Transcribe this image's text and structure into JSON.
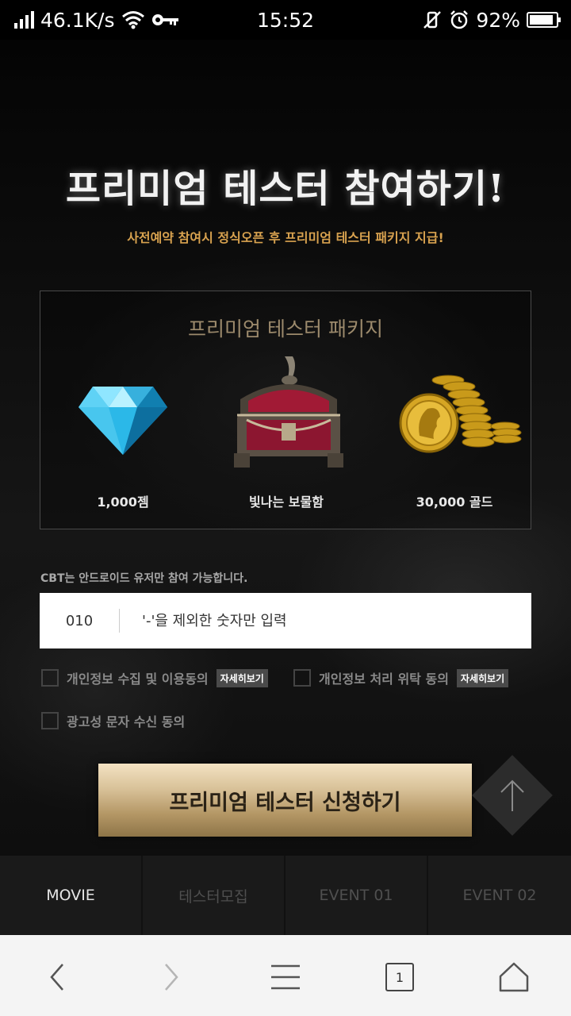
{
  "status_bar": {
    "speed": "46.1K/s",
    "time": "15:52",
    "battery": "92%",
    "battery_fraction": 0.92
  },
  "hero": {
    "title": "프리미엄 테스터 참여하기!",
    "subtitle": "사전예약 참여시 정식오픈 후 프리미엄 테스터 패키지 지급!"
  },
  "package": {
    "title": "프리미엄 테스터 패키지",
    "items": [
      {
        "label": "1,000젬",
        "icon": "gem-icon"
      },
      {
        "label": "빛나는 보물함",
        "icon": "treasure-chest-icon"
      },
      {
        "label": "30,000 골드",
        "icon": "gold-coins-icon"
      }
    ]
  },
  "form": {
    "notice": "CBT는 안드로이드 유저만 참여 가능합니다.",
    "phone_prefix": "010",
    "phone_placeholder": "'-'을 제외한 숫자만 입력",
    "agreements": [
      {
        "label": "개인정보 수집 및 이용동의",
        "detail": "자세히보기"
      },
      {
        "label": "개인정보 처리 위탁 동의",
        "detail": "자세히보기"
      },
      {
        "label": "광고성 문자 수신 동의"
      }
    ],
    "submit_label": "프리미엄 테스터 신청하기"
  },
  "tabs": [
    {
      "label": "MOVIE",
      "active": true
    },
    {
      "label": "테스터모집",
      "active": false
    },
    {
      "label": "EVENT 01",
      "active": false
    },
    {
      "label": "EVENT 02",
      "active": false
    }
  ],
  "browser": {
    "tab_count": "1"
  },
  "colors": {
    "accent_gold": "#d8a24f",
    "cta_gold": "#c9ae7f",
    "tab_bg": "#1a1a1a"
  }
}
